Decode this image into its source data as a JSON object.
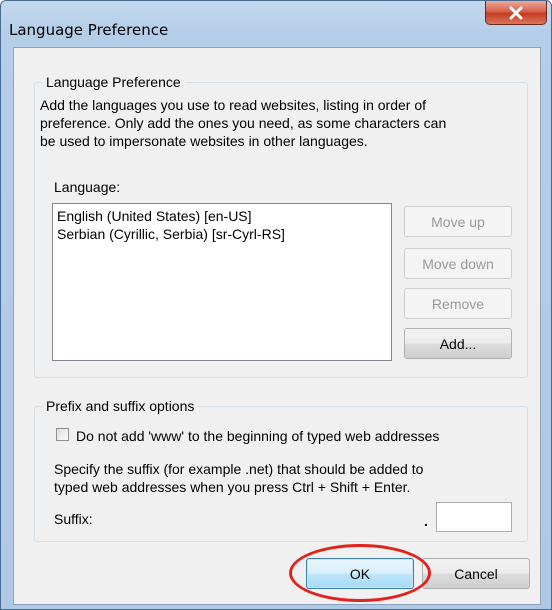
{
  "window": {
    "title": "Language Preference"
  },
  "language_group": {
    "legend": "Language Preference",
    "description_lines": [
      "Add the languages you use to read websites, listing in order of",
      "preference. Only add the ones you need, as some characters can",
      "be used to impersonate websites in other languages."
    ],
    "language_label": "Language:",
    "languages": [
      "English (United States) [en-US]",
      "Serbian (Cyrillic, Serbia) [sr-Cyrl-RS]"
    ],
    "buttons": {
      "move_up": "Move up",
      "move_down": "Move down",
      "remove": "Remove",
      "add": "Add..."
    }
  },
  "prefix_group": {
    "legend": "Prefix and suffix options",
    "checkbox_label": "Do not add 'www' to the beginning of typed web addresses",
    "checkbox_checked": false,
    "suffix_description_lines": [
      "Specify the suffix (for example .net) that should be added to",
      "typed web addresses when you press Ctrl + Shift + Enter."
    ],
    "suffix_label": "Suffix:",
    "suffix_dot": ".",
    "suffix_value": ""
  },
  "dialog_buttons": {
    "ok": "OK",
    "cancel": "Cancel"
  },
  "colors": {
    "annotation_red": "#e2221c",
    "close_button": "#c43c21"
  }
}
